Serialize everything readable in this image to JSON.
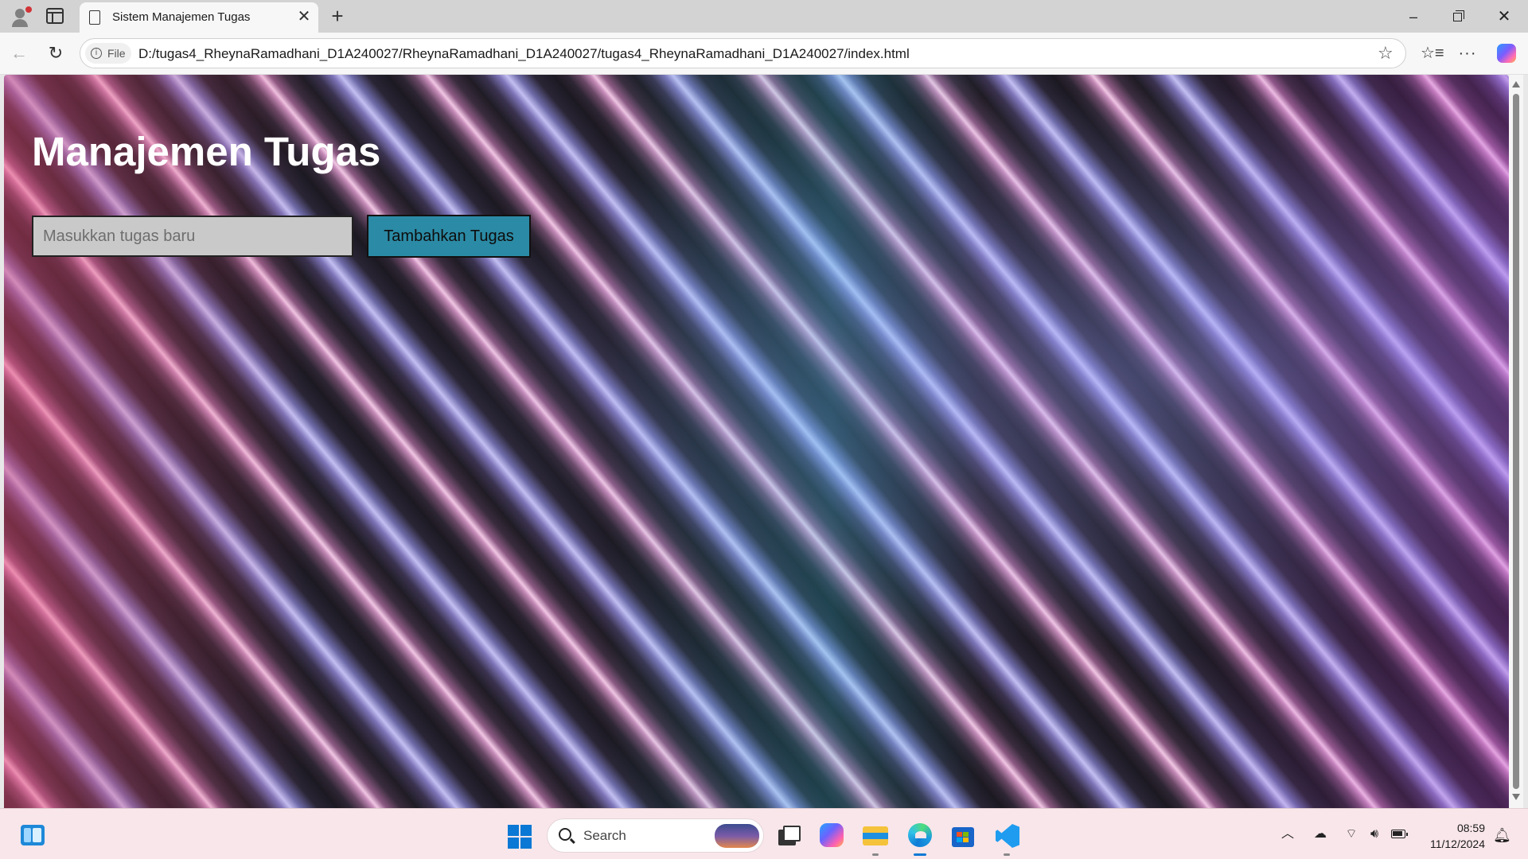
{
  "browser": {
    "tab_title": "Sistem Manajemen Tugas",
    "tab_close_glyph": "✕",
    "new_tab_glyph": "+",
    "address": {
      "scheme_label": "File",
      "url": "D:/tugas4_RheynaRamadhani_D1A240027/RheynaRamadhani_D1A240027/tugas4_RheynaRamadhani_D1A240027/index.html"
    },
    "icons": {
      "back": "back-arrow-icon",
      "reload": "reload-icon",
      "favorite": "star-icon",
      "favorites_bar": "favorites-icon",
      "more": "more-icon",
      "copilot": "copilot-icon"
    }
  },
  "page": {
    "title": "Manajemen Tugas",
    "task_input_placeholder": "Masukkan tugas baru",
    "task_input_value": "",
    "add_button_label": "Tambahkan Tugas",
    "colors": {
      "title": "#ffffff",
      "input_bg": "#c9c9c9",
      "button_bg": "#2b8aa5"
    }
  },
  "taskbar": {
    "search_label": "Search",
    "apps": [
      "widgets",
      "start",
      "task-view",
      "copilot",
      "file-explorer",
      "edge",
      "microsoft-store",
      "vs-code"
    ],
    "clock_time": "08:59",
    "clock_date": "11/12/2024"
  }
}
